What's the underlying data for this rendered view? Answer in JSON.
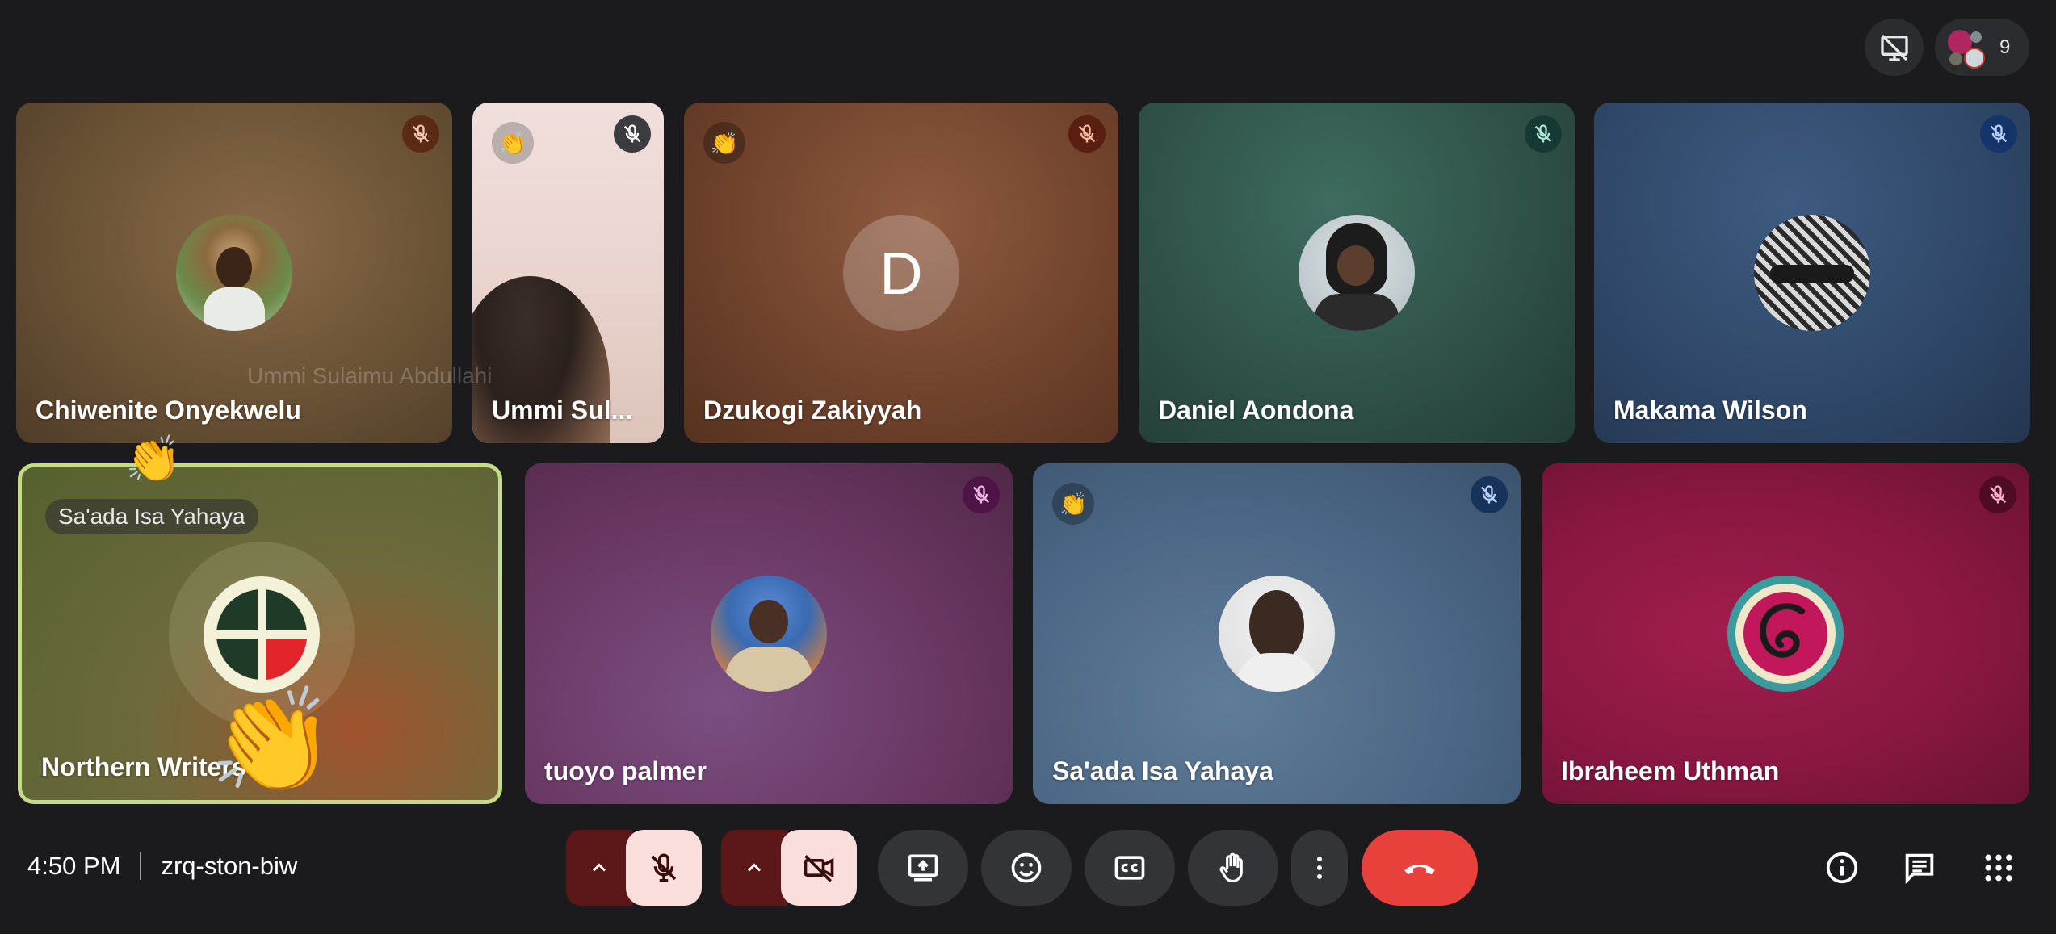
{
  "meeting": {
    "time": "4:50 PM",
    "code": "zrq-ston-biw",
    "participant_count": "9"
  },
  "tiles": [
    {
      "name": "Chiwenite Onyekwelu",
      "muted": true,
      "hand_raised": false
    },
    {
      "name": "Ummi Sul...",
      "muted": true,
      "hand_raised": true
    },
    {
      "name": "Dzukogi Zakiyyah",
      "muted": true,
      "hand_raised": true,
      "initial": "D"
    },
    {
      "name": "Daniel Aondona",
      "muted": true,
      "hand_raised": false
    },
    {
      "name": "Makama Wilson",
      "muted": true,
      "hand_raised": false
    },
    {
      "name": "Northern Writers' ... n",
      "muted": false,
      "hand_raised": true,
      "active_speaker": true
    },
    {
      "name": "tuoyo palmer",
      "muted": true,
      "hand_raised": false
    },
    {
      "name": "Sa'ada Isa Yahaya",
      "muted": true,
      "hand_raised": true
    },
    {
      "name": "Ibraheem Uthman",
      "muted": true,
      "hand_raised": false
    }
  ],
  "overlays": {
    "reaction_label": "Sa'ada Isa Yahaya",
    "faded_label": "Ummi Sulaimu Abdullahi",
    "reaction_emoji": "👏"
  },
  "controls": {
    "mic": "mic-off",
    "camera": "camera-off",
    "buttons": [
      "present-screen",
      "reactions",
      "captions",
      "raise-hand",
      "more-options",
      "leave-call"
    ]
  },
  "colors": {
    "background": "#1b1b1d",
    "leave": "#e8403a",
    "off_toggle": "#f9dedc",
    "active_border": "#c5dc86"
  }
}
